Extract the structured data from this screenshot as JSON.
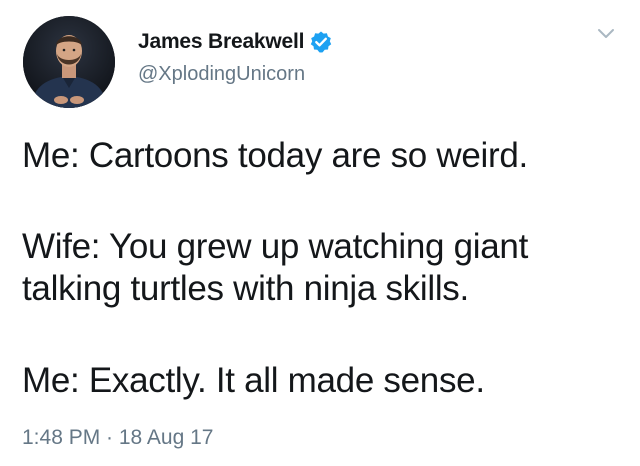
{
  "author": {
    "display_name": "James Breakwell",
    "handle": "@XplodingUnicorn",
    "verified": true,
    "avatar_icon": "user-avatar-photo"
  },
  "tweet": {
    "paragraphs": [
      "Me: Cartoons today are so weird.",
      "Wife: You grew up watching giant",
      "talking turtles with ninja skills.",
      "Me: Exactly. It all made sense."
    ],
    "timestamp": "1:48 PM · 18 Aug 17"
  },
  "menu": {
    "icon": "chevron-down-icon"
  },
  "colors": {
    "text": "#14171a",
    "secondary": "#657786",
    "verified_badge": "#1da1f2",
    "chevron": "#aab8c2"
  }
}
